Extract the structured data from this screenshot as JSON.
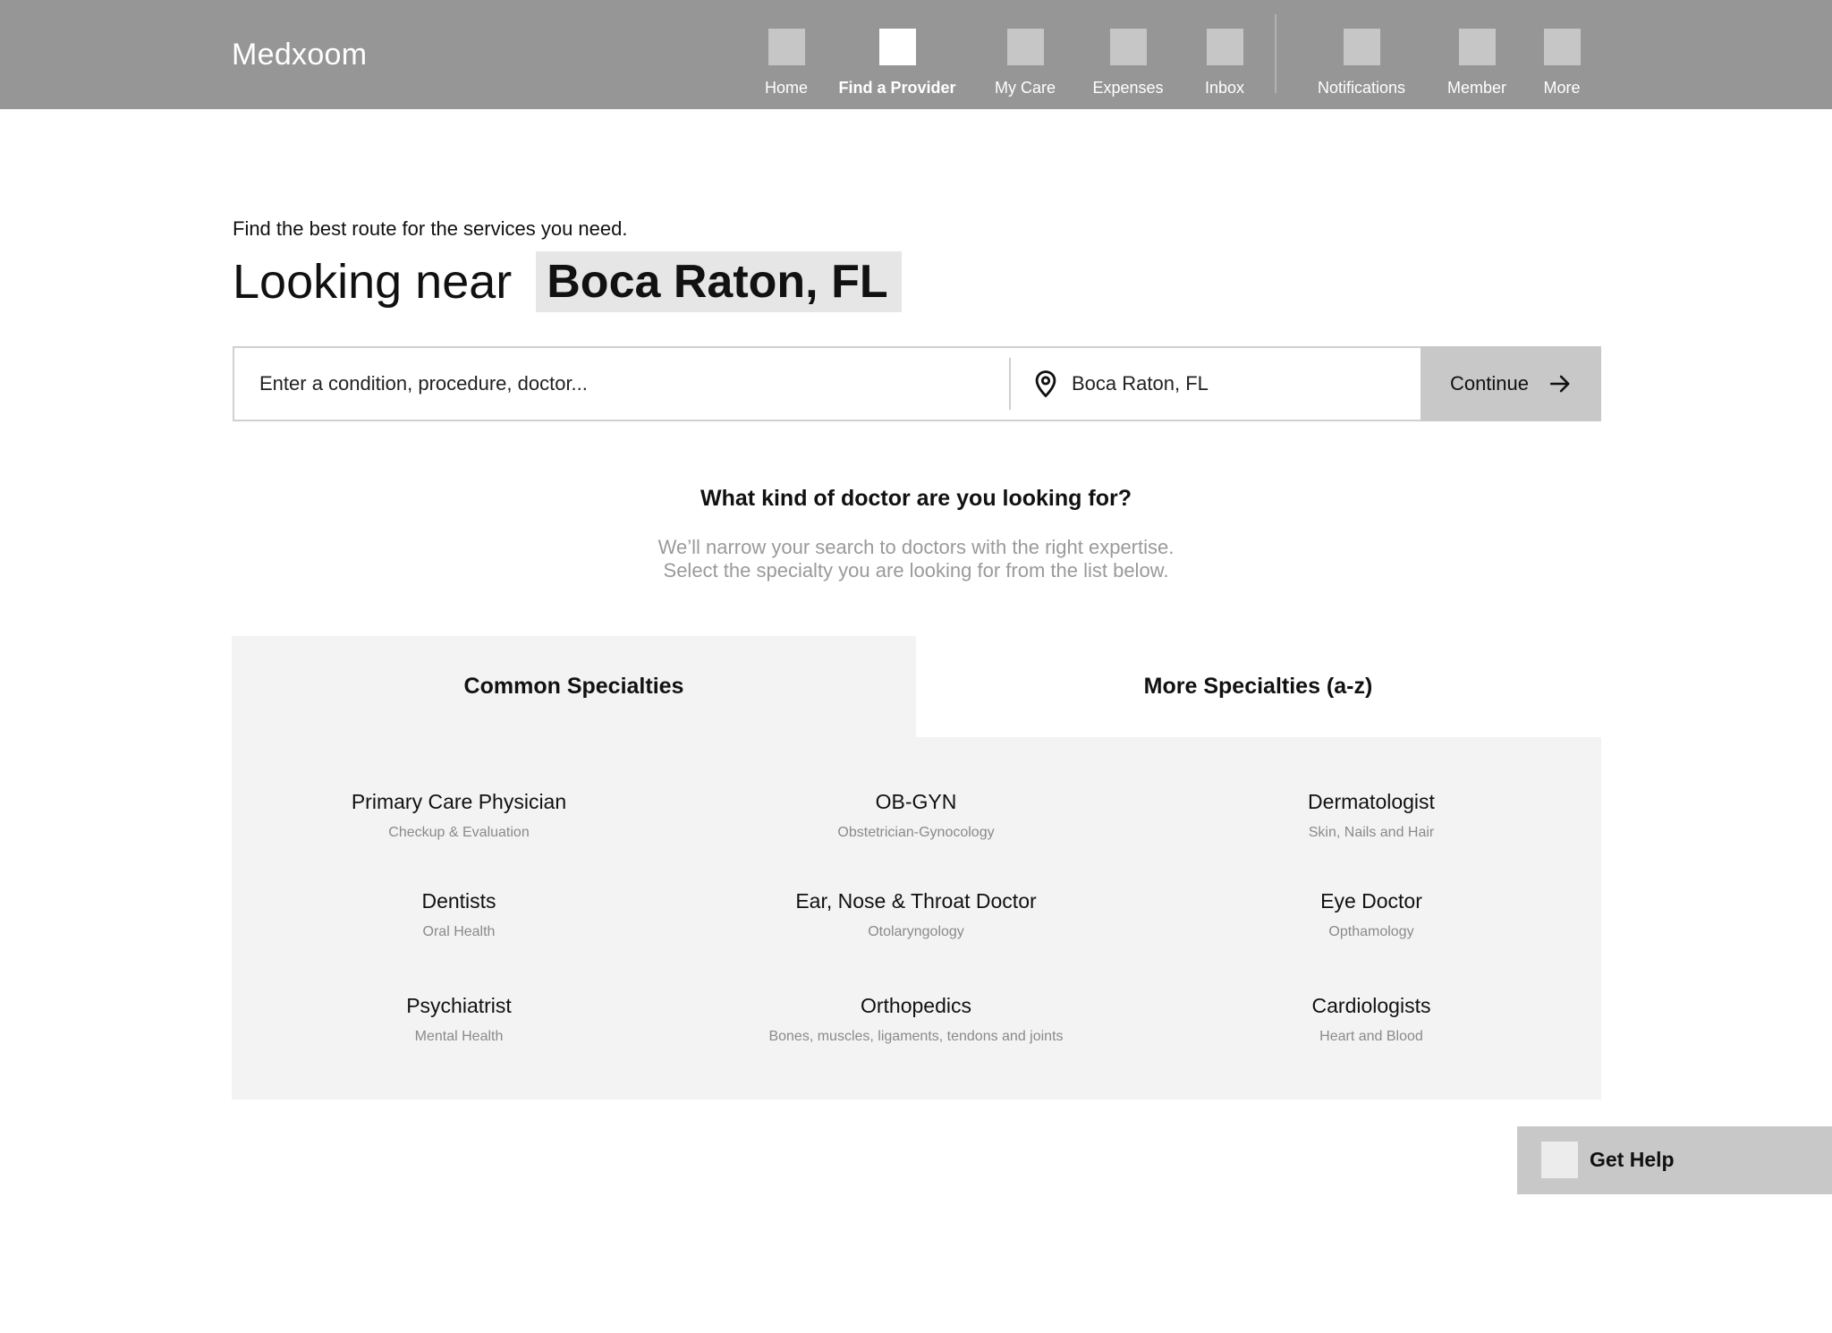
{
  "brand": "Medxoom",
  "nav": [
    {
      "label": "Home",
      "icon": "home-icon",
      "active": false
    },
    {
      "label": "Find a Provider",
      "icon": "find-provider-icon",
      "active": true
    },
    {
      "label": "My Care",
      "icon": "my-care-icon",
      "active": false
    },
    {
      "label": "Expenses",
      "icon": "expenses-icon",
      "active": false
    },
    {
      "label": "Inbox",
      "icon": "inbox-icon",
      "active": false
    },
    {
      "label": "Notifications",
      "icon": "notifications-icon",
      "active": false
    },
    {
      "label": "Member",
      "icon": "member-icon",
      "active": false
    },
    {
      "label": "More",
      "icon": "more-icon",
      "active": false
    }
  ],
  "hero": {
    "intro": "Find the best route for the services you need.",
    "heading_prefix": "Looking near ",
    "heading_location": "Boca Raton, FL"
  },
  "search": {
    "query_placeholder": "Enter a condition, procedure, doctor...",
    "location_value": "Boca Raton, FL",
    "location_icon": "location-pin-icon",
    "continue_label": "Continue",
    "continue_icon": "arrow-right-icon"
  },
  "question": {
    "title": "What kind of doctor are you looking for?",
    "line1": "We’ll narrow your search to doctors with the right expertise.",
    "line2": "Select the specialty you are looking for from the list below."
  },
  "tabs": [
    {
      "label": "Common Specialties",
      "active": true
    },
    {
      "label": "More Specialties (a-z)",
      "active": false
    }
  ],
  "specialties": [
    {
      "name": "Primary Care Physician",
      "desc": "Checkup & Evaluation"
    },
    {
      "name": "OB-GYN",
      "desc": "Obstetrician-Gynocology"
    },
    {
      "name": "Dermatologist",
      "desc": "Skin, Nails and Hair"
    },
    {
      "name": "Dentists",
      "desc": "Oral Health"
    },
    {
      "name": "Ear, Nose & Throat Doctor",
      "desc": "Otolaryngology"
    },
    {
      "name": "Eye Doctor",
      "desc": "Opthamology"
    },
    {
      "name": "Psychiatrist",
      "desc": "Mental Health"
    },
    {
      "name": "Orthopedics",
      "desc": "Bones, muscles, ligaments, tendons and joints"
    },
    {
      "name": "Cardiologists",
      "desc": "Heart and Blood"
    }
  ],
  "help": {
    "label": "Get Help",
    "icon": "help-icon"
  },
  "colors": {
    "header_bg": "#969696",
    "panel_bg": "#f3f3f3",
    "button_bg": "#c8c8c8",
    "highlight_bg": "#e6e6e6"
  }
}
